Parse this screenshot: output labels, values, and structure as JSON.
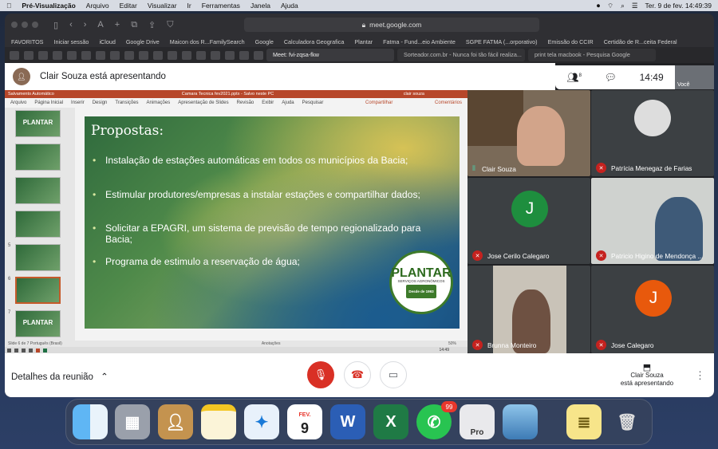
{
  "menubar": {
    "app": "Pré-Visualização",
    "items": [
      "Arquivo",
      "Editar",
      "Visualizar",
      "Ir",
      "Ferramentas",
      "Janela",
      "Ajuda"
    ],
    "datetime": "Ter. 9 de fev.  14:49:39"
  },
  "browser": {
    "url": "meet.google.com",
    "favorites_label": "FAVORITOS",
    "favorites": [
      "Iniciar sessão",
      "iCloud",
      "Google Drive",
      "Maicon dos R...FamilySearch",
      "Google",
      "Calculadora Geografica",
      "Plantar",
      "Fatma - Fund...eio Ambiente",
      "SGPE FATMA (...orporativo)",
      "Emissão do CCIR",
      "Certidão de R...ceita Federal"
    ],
    "tabs": [
      "Meet: fvi-zqsa-fkw",
      "Sorteador.com.br - Nunca foi tão fácil realiza...",
      "print tela macbook - Pesquisa Google"
    ]
  },
  "meet": {
    "presenting_title": "Clair Souza está apresentando",
    "participants_count": "8",
    "time": "14:49",
    "self_label": "Você",
    "details_label": "Detalhes da reunião",
    "presenting_status": "Clair Souza\nestá apresentando"
  },
  "ppt": {
    "autosave": "Salvamento Automático",
    "filename": "Camara Tecnica fev2021.pptx  -  Salvo neste PC",
    "user": "clair souza",
    "menu": [
      "Arquivo",
      "Página Inicial",
      "Inserir",
      "Design",
      "Transições",
      "Animações",
      "Apresentação de Slides",
      "Revisão",
      "Exibir",
      "Ajuda"
    ],
    "search": "Pesquisar",
    "share": "Compartilhar",
    "comments": "Comentários",
    "status": "Slide 6 de 7     Português (Brasil)",
    "notes": "Anotações",
    "zoom": "50%",
    "clock": "14:49",
    "thumb_nums": [
      "5",
      "6",
      "7"
    ],
    "thumb_title": "PLANTAR",
    "slide_title": "Propostas:",
    "bullets": [
      "Instalação de estações automáticas em todos os municípios da Bacia;",
      "Estimular produtores/empresas a instalar estações e compartilhar dados;",
      "Solicitar a EPAGRI, um sistema de previsão de tempo regionalizado para Bacia;",
      "Programa de estimulo a reservação de água;"
    ],
    "logo_title": "PLANTAR",
    "logo_sub": "SERVIÇOS AGRONÔMICOS",
    "logo_seal": "Desde de 1993"
  },
  "participants": [
    {
      "name": "Clair Souza"
    },
    {
      "name": "Patrícia Menegaz de Farias"
    },
    {
      "name": "Jose Cerilo Calegaro",
      "initial": "J",
      "color": "#1e8e3e"
    },
    {
      "name": "Patricio Higino de Mendonça ..."
    },
    {
      "name": "Brunna Monteiro"
    },
    {
      "name": "Jose Calegaro",
      "initial": "J",
      "color": "#e8590c"
    }
  ],
  "dock": {
    "calendar_month": "FEV.",
    "calendar_day": "9",
    "whatsapp_badge": "99",
    "word": "W",
    "excel": "X",
    "pro": "Pro"
  }
}
